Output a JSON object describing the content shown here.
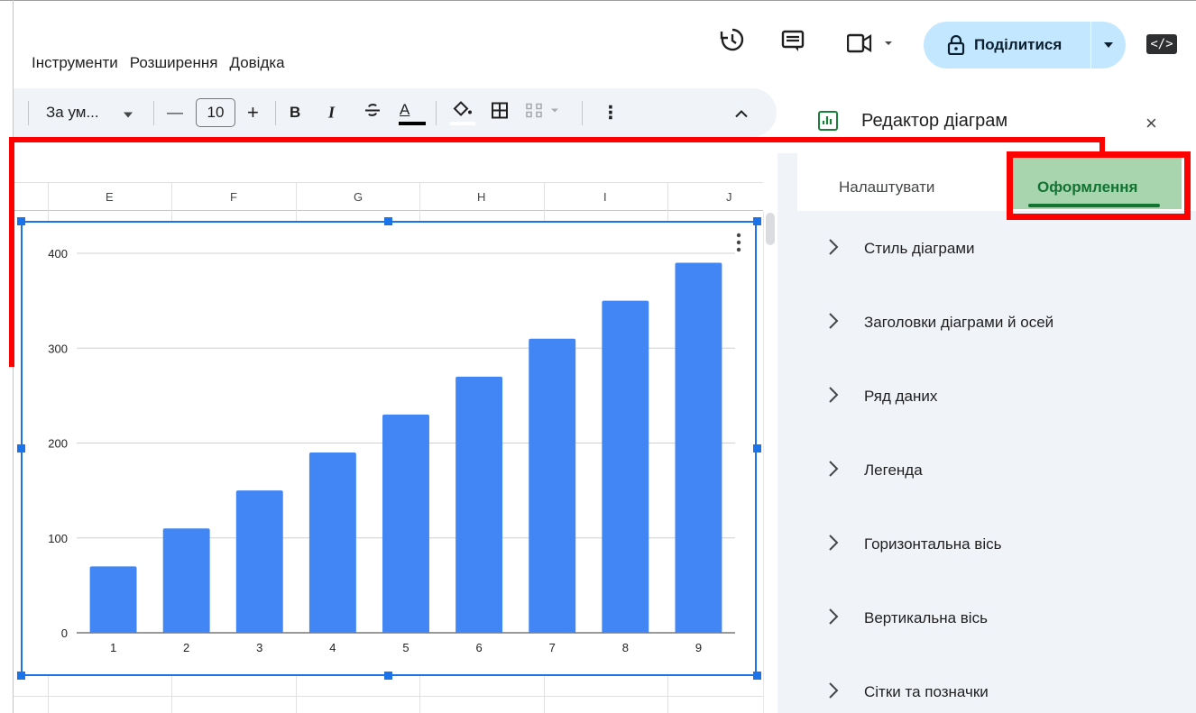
{
  "menu": {
    "items": [
      "Інструменти",
      "Розширення",
      "Довідка"
    ]
  },
  "header": {
    "share_label": "Поділитися",
    "embed_label": "</>"
  },
  "toolbar": {
    "font_label": "За ум...",
    "font_size": "10",
    "minus": "—",
    "plus": "+",
    "bold": "B",
    "italic": "I",
    "text_color_label": "A",
    "more": "⋮",
    "collapse": "^"
  },
  "sheet": {
    "columns": [
      "E",
      "F",
      "G",
      "H",
      "I",
      "J"
    ]
  },
  "chart_data": {
    "type": "bar",
    "categories": [
      "1",
      "2",
      "3",
      "4",
      "5",
      "6",
      "7",
      "8",
      "9"
    ],
    "values": [
      70,
      110,
      150,
      190,
      230,
      270,
      310,
      350,
      390
    ],
    "ylim": [
      0,
      400
    ],
    "yticks": [
      "0",
      "100",
      "200",
      "300",
      "400"
    ],
    "grid": true,
    "legend": "none",
    "bar_color": "#4285f4"
  },
  "panel": {
    "title": "Редактор діаграм",
    "close": "×",
    "tabs": {
      "customize": "Налаштувати",
      "design": "Оформлення"
    },
    "sections": [
      "Стиль діаграми",
      "Заголовки діаграми й осей",
      "Ряд даних",
      "Легенда",
      "Горизонтальна вісь",
      "Вертикальна вісь",
      "Сітки та позначки"
    ]
  },
  "colors": {
    "accent": "#1a73e8",
    "share_bg": "#c2e7ff",
    "highlight": "#ff0000",
    "tab_active": "#137333"
  },
  "icons": [
    "history-icon",
    "comment-icon",
    "meet-icon",
    "lock-icon",
    "chart-icon",
    "close-icon",
    "chevron-right-icon"
  ]
}
